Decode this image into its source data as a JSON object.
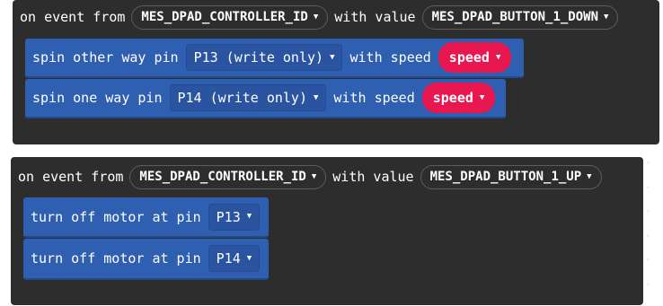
{
  "block1": {
    "on_event_from": "on event from",
    "controller_id": "MES_DPAD_CONTROLLER_ID",
    "with_value": "with value",
    "value": "MES_DPAD_BUTTON_1_DOWN",
    "stmt1": {
      "text": "spin other way pin",
      "pin": "P13 (write only)",
      "with_speed": "with speed",
      "speed": "speed"
    },
    "stmt2": {
      "text": "spin one way pin",
      "pin": "P14 (write only)",
      "with_speed": "with speed",
      "speed": "speed"
    }
  },
  "block2": {
    "on_event_from": "on event from",
    "controller_id": "MES_DPAD_CONTROLLER_ID",
    "with_value": "with value",
    "value": "MES_DPAD_BUTTON_1_UP",
    "stmt1": {
      "text": "turn off motor at pin",
      "pin": "P13"
    },
    "stmt2": {
      "text": "turn off motor at pin",
      "pin": "P14"
    }
  },
  "icons": {
    "dropdown_caret": "caret-down-icon"
  }
}
